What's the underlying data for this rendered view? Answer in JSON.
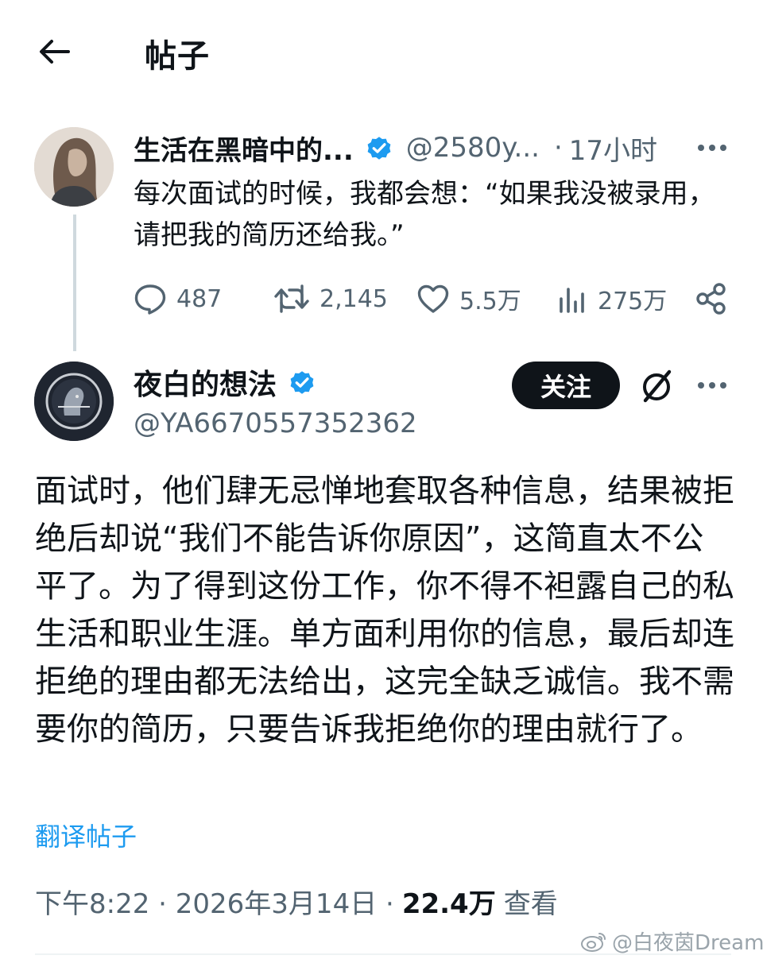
{
  "header": {
    "title": "帖子",
    "back_icon": "arrow-left-icon"
  },
  "quoted_post": {
    "author_name": "生活在黑暗中的...",
    "handle": "@2580y...",
    "dot": "·",
    "time": "17小时",
    "text": "每次面试的时候，我都会想：“如果我没被录用，请把我的简历还给我。”",
    "reply_count": "487",
    "repost_count": "2,145",
    "like_count": "5.5万",
    "view_count": "275万"
  },
  "reply_post": {
    "author_name": "夜白的想法",
    "handle": "@YA6670557352362",
    "follow_label": "关注",
    "text": "面试时，他们肆无忌惮地套取各种信息，结果被拒绝后却说“我们不能告诉你原因”，这简直太不公平了。为了得到这份工作，你不得不袒露自己的私生活和职业生涯。单方面利用你的信息，最后却连拒绝的理由都无法给出，这完全缺乏诚信。我不需要你的简历，只要告诉我拒绝你的理由就行了。",
    "translate_label": "翻译帖子",
    "timestamp": "下午8:22 · 2026年3月14日 ·",
    "views": "22.4万",
    "views_label": "查看"
  },
  "watermark": "@白夜茵Dream",
  "colors": {
    "accent": "#1d9bf0",
    "text": "#0f1419",
    "secondary": "#536471"
  }
}
